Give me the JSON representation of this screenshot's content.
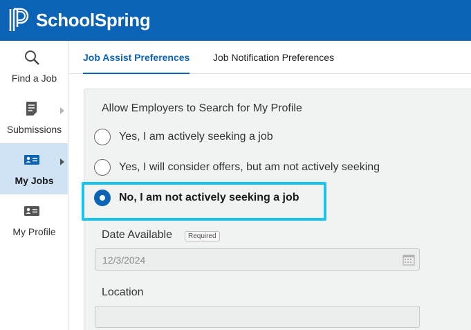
{
  "header": {
    "brand": "SchoolSpring",
    "logo_icon": "schoolspring-logo-icon"
  },
  "sidebar": {
    "items": [
      {
        "label": "Find a Job",
        "icon": "search-icon"
      },
      {
        "label": "Submissions",
        "icon": "document-icon"
      },
      {
        "label": "My Jobs",
        "icon": "id-card-icon",
        "active": true
      },
      {
        "label": "My Profile",
        "icon": "profile-card-icon"
      }
    ]
  },
  "tabs": [
    {
      "label": "Job Assist Preferences",
      "active": true
    },
    {
      "label": "Job Notification Preferences",
      "active": false
    }
  ],
  "form": {
    "section_title": "Allow Employers to Search for My Profile",
    "options": [
      {
        "label": "Yes, I am actively seeking a job",
        "checked": false
      },
      {
        "label": "Yes, I will consider offers, but am not actively seeking",
        "checked": false
      },
      {
        "label": "No, I am not actively seeking a job",
        "checked": true
      }
    ],
    "date_available_label": "Date Available",
    "required_badge": "Required",
    "date_available_value": "12/3/2024",
    "location_label": "Location",
    "location_value": ""
  },
  "colors": {
    "brand_blue": "#0b63b6",
    "highlight": "#18c5ec",
    "active_sidebar": "#cfe3f5"
  }
}
